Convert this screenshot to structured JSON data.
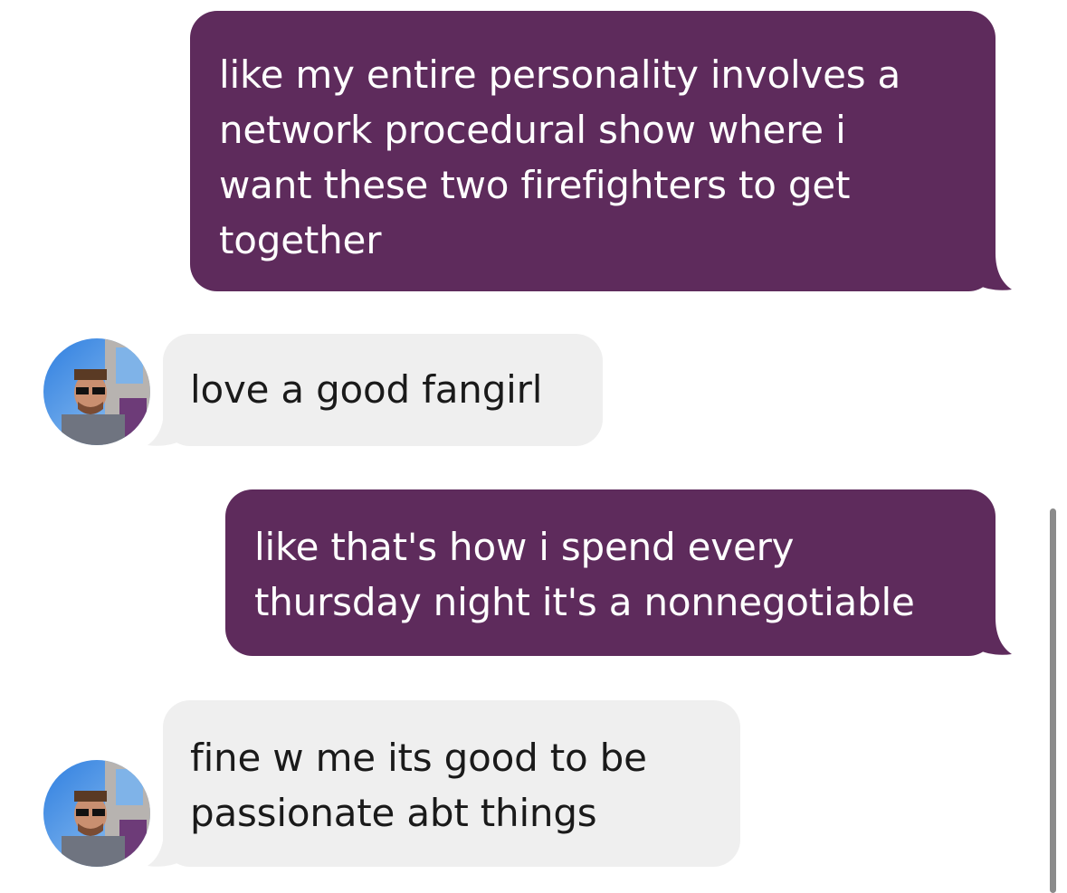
{
  "messages": [
    {
      "direction": "sent",
      "lines": [
        "like my entire personality involves a",
        "network procedural show where i",
        "want these two firefighters to get",
        "together"
      ]
    },
    {
      "direction": "received",
      "lines": [
        "love a good fangirl"
      ]
    },
    {
      "direction": "sent",
      "lines": [
        "like that's how i spend every",
        "thursday night it's a nonnegotiable"
      ]
    },
    {
      "direction": "received",
      "lines": [
        "fine w me its good to be",
        "passionate abt things"
      ]
    }
  ],
  "colors": {
    "sent_bubble": "#5e2b5c",
    "received_bubble": "#efefef",
    "sent_text": "#ffffff",
    "received_text": "#1a1a1a"
  },
  "icons": {
    "avatar": "contact-avatar-photo",
    "scrollbar": "vertical-scroll-indicator"
  }
}
